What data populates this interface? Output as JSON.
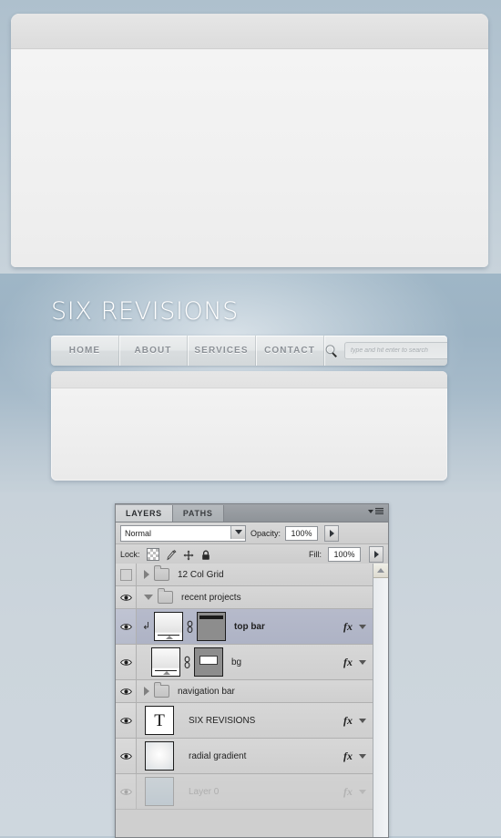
{
  "background": {
    "accent_steel": "#9fb6c6",
    "accent_light": "#cfd8df"
  },
  "top_window": {
    "name": "content-box"
  },
  "site": {
    "title": "SIX REVISIONS",
    "nav": [
      {
        "label": "HOME"
      },
      {
        "label": "ABOUT"
      },
      {
        "label": "SERVICES"
      },
      {
        "label": "CONTACT"
      }
    ],
    "search": {
      "icon": "search-icon",
      "placeholder": "type and hit enter to search",
      "value": ""
    }
  },
  "photoshop": {
    "tabs": [
      {
        "label": "LAYERS",
        "active": true
      },
      {
        "label": "PATHS",
        "active": false
      }
    ],
    "menu_icon": "panel-menu-icon",
    "blend": {
      "mode": "Normal",
      "opacity_label": "Opacity:",
      "opacity_value": "100%"
    },
    "lock": {
      "label": "Lock:",
      "icons": [
        "lock-transparency-icon",
        "lock-image-icon",
        "lock-position-icon",
        "lock-all-icon"
      ],
      "fill_label": "Fill:",
      "fill_value": "100%"
    },
    "layers": [
      {
        "name": "12 Col Grid",
        "kind": "group",
        "visible": false,
        "expanded": false,
        "selected": false,
        "has_fx": false,
        "dimmed": false
      },
      {
        "name": "recent projects",
        "kind": "group",
        "visible": true,
        "expanded": true,
        "selected": false,
        "has_fx": false,
        "dimmed": false
      },
      {
        "name": "top bar",
        "kind": "layer",
        "visible": true,
        "clipped": true,
        "selected": true,
        "has_fx": true,
        "has_mask": true,
        "linked": true,
        "dimmed": false
      },
      {
        "name": "bg",
        "kind": "layer",
        "visible": true,
        "clipped": false,
        "selected": false,
        "has_fx": true,
        "has_mask": true,
        "linked": true,
        "dimmed": false
      },
      {
        "name": "navigation bar",
        "kind": "group",
        "visible": true,
        "expanded": false,
        "selected": false,
        "has_fx": false,
        "dimmed": false
      },
      {
        "name": "SIX REVISIONS",
        "kind": "text",
        "thumb_glyph": "T",
        "visible": true,
        "selected": false,
        "has_fx": true,
        "dimmed": false
      },
      {
        "name": "radial gradient",
        "kind": "layer",
        "visible": true,
        "selected": false,
        "has_fx": true,
        "dimmed": false
      },
      {
        "name": "Layer 0",
        "kind": "layer",
        "visible": true,
        "selected": false,
        "has_fx": true,
        "dimmed": true
      }
    ],
    "scrollbar": {
      "up_icon": "scroll-up-arrow-icon"
    }
  }
}
